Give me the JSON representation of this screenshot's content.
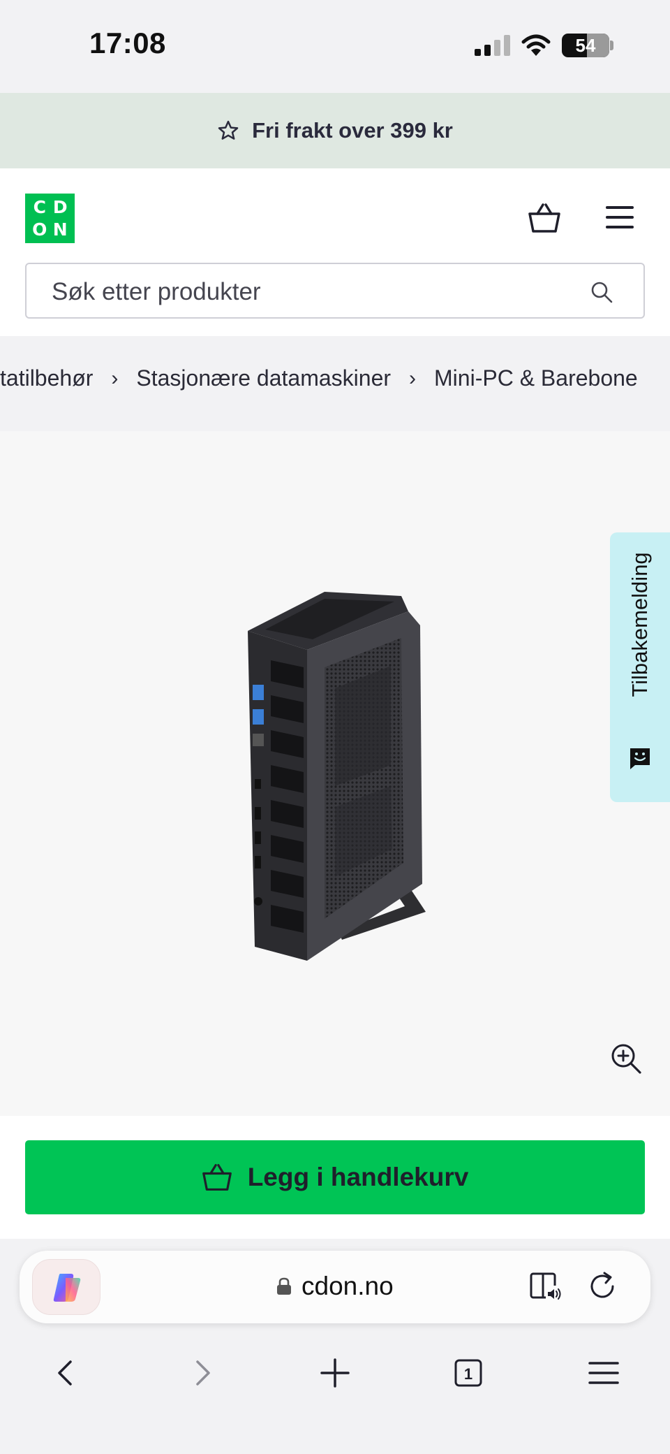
{
  "status_bar": {
    "time": "17:08",
    "battery": "54"
  },
  "promo": {
    "icon": "star-icon",
    "text": "Fri frakt over 399 kr"
  },
  "header": {
    "logo": {
      "letters": [
        "C",
        "D",
        "O",
        "N"
      ],
      "brand_color": "#00bf52"
    },
    "cart_icon": "basket-icon",
    "menu_icon": "hamburger-menu-icon"
  },
  "search": {
    "placeholder": "Søk etter produkter",
    "icon": "search-icon"
  },
  "breadcrumb": {
    "items": [
      "tatilbehør",
      "Stasjonære datamaskiner",
      "Mini-PC & Barebone"
    ],
    "separator": "›"
  },
  "gallery": {
    "image": "mini-pc-product-image",
    "zoom_icon": "zoom-in-icon"
  },
  "feedback": {
    "label": "Tilbakemelding",
    "background": "#c8f0f4"
  },
  "cta": {
    "label": "Legg i handlekurv",
    "color": "#00c455"
  },
  "browser": {
    "url": "cdon.no",
    "copilot_icon": "copilot-icon",
    "reader_icon": "reader-audio-icon",
    "reload_icon": "reload-icon",
    "tab_count": "1",
    "nav": [
      "back-icon",
      "forward-icon",
      "new-tab-icon",
      "tabs-icon",
      "menu-icon"
    ]
  }
}
